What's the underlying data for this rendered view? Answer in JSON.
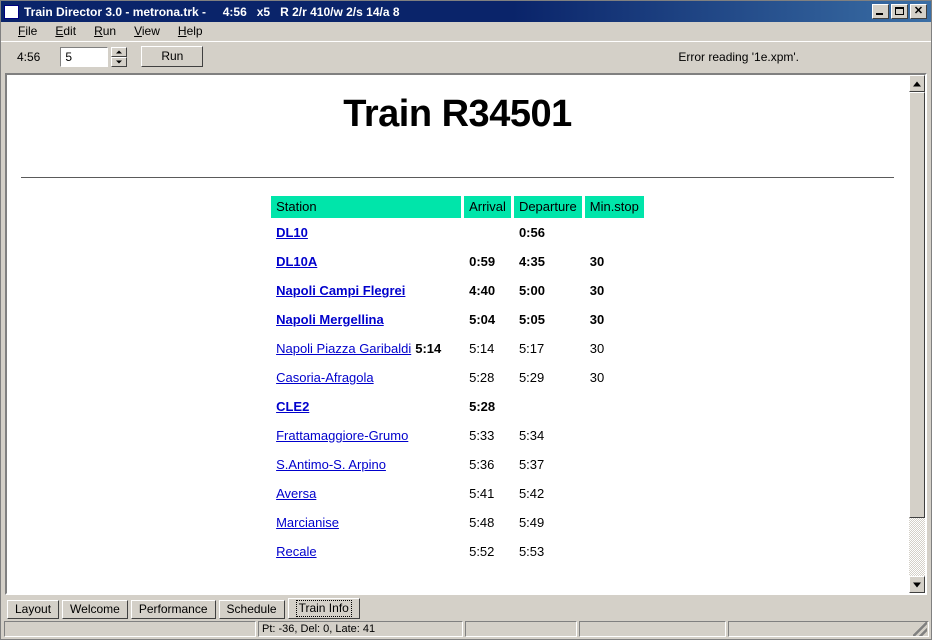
{
  "window": {
    "title": "Train Director 3.0 - metrona.trk -     4:56   x5   R 2/r 410/w 2/s 14/a 8",
    "icon": "app-icon",
    "minimize_label": "_",
    "maximize_label": "□",
    "close_label": "✕"
  },
  "menu": {
    "items": [
      {
        "mnemonic": "F",
        "rest": "ile"
      },
      {
        "mnemonic": "E",
        "rest": "dit"
      },
      {
        "mnemonic": "R",
        "rest": "un"
      },
      {
        "mnemonic": "V",
        "rest": "iew"
      },
      {
        "mnemonic": "H",
        "rest": "elp"
      }
    ]
  },
  "toolbar": {
    "clock": "4:56",
    "speed_value": "5",
    "run_label": "Run",
    "status_message": "Error reading '1e.xpm'."
  },
  "document": {
    "heading": "Train R34501",
    "table": {
      "headers": {
        "station": "Station",
        "arrival": "Arrival",
        "departure": "Departure",
        "min_stop": "Min.stop"
      },
      "rows": [
        {
          "station": "DL10",
          "extra": "",
          "arrival": "",
          "departure": "0:56",
          "min_stop": "",
          "bold": true
        },
        {
          "station": "DL10A",
          "extra": "",
          "arrival": "0:59",
          "departure": "4:35",
          "min_stop": "30",
          "bold": true
        },
        {
          "station": "Napoli Campi Flegrei",
          "extra": "",
          "arrival": "4:40",
          "departure": "5:00",
          "min_stop": "30",
          "bold": true
        },
        {
          "station": "Napoli Mergellina",
          "extra": "",
          "arrival": "5:04",
          "departure": "5:05",
          "min_stop": "30",
          "bold": true
        },
        {
          "station": "Napoli Piazza Garibaldi",
          "extra": "5:14",
          "arrival": "5:14",
          "departure": "5:17",
          "min_stop": "30",
          "bold": false
        },
        {
          "station": "Casoria-Afragola",
          "extra": "",
          "arrival": "5:28",
          "departure": "5:29",
          "min_stop": "30",
          "bold": false
        },
        {
          "station": "CLE2",
          "extra": "",
          "arrival": "5:28",
          "departure": "",
          "min_stop": "",
          "bold": true
        },
        {
          "station": "Frattamaggiore-Grumo",
          "extra": "",
          "arrival": "5:33",
          "departure": "5:34",
          "min_stop": "",
          "bold": false
        },
        {
          "station": "S.Antimo-S. Arpino",
          "extra": "",
          "arrival": "5:36",
          "departure": "5:37",
          "min_stop": "",
          "bold": false
        },
        {
          "station": "Aversa",
          "extra": "",
          "arrival": "5:41",
          "departure": "5:42",
          "min_stop": "",
          "bold": false
        },
        {
          "station": "Marcianise",
          "extra": "",
          "arrival": "5:48",
          "departure": "5:49",
          "min_stop": "",
          "bold": false
        },
        {
          "station": "Recale",
          "extra": "",
          "arrival": "5:52",
          "departure": "5:53",
          "min_stop": "",
          "bold": false
        }
      ]
    }
  },
  "tabs": [
    {
      "label": "Layout",
      "selected": false
    },
    {
      "label": "Welcome",
      "selected": false
    },
    {
      "label": "Performance",
      "selected": false
    },
    {
      "label": "Schedule",
      "selected": false
    },
    {
      "label": "Train Info",
      "selected": true
    }
  ],
  "statusbar": {
    "panel1": "",
    "panel2": "Pt: -36, Del:  0, Late:  41",
    "panel3": "",
    "panel4": "",
    "panel5": ""
  },
  "colors": {
    "header_cell_bg": "#00e5aa",
    "link": "#0000cc",
    "chrome": "#d4d0c8",
    "titlebar": "#0a246a"
  }
}
